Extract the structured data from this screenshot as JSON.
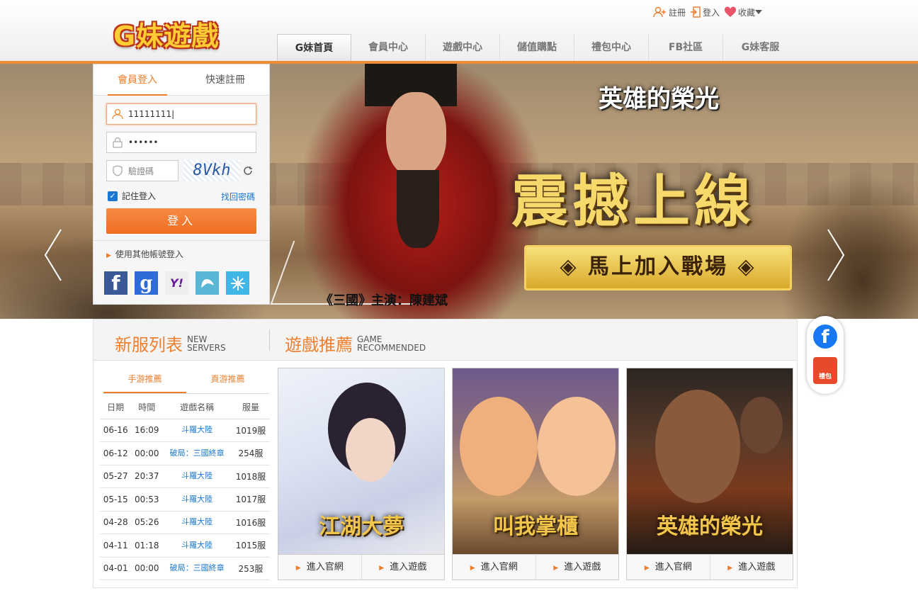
{
  "site": {
    "logo_text": "G妹遊戲"
  },
  "top_links": [
    {
      "label": "註冊",
      "icon": "add-user-icon"
    },
    {
      "label": "登入",
      "icon": "login-icon"
    },
    {
      "label": "收藏",
      "icon": "heart-icon"
    }
  ],
  "nav": [
    {
      "label": "G妹首頁",
      "active": true
    },
    {
      "label": "會員中心"
    },
    {
      "label": "遊戲中心"
    },
    {
      "label": "儲值購點"
    },
    {
      "label": "禮包中心"
    },
    {
      "label": "FB社區"
    },
    {
      "label": "G妹客服"
    }
  ],
  "login": {
    "tab_login": "會員登入",
    "tab_register": "快速註冊",
    "username_value": "11111111",
    "password_value": "••••••",
    "captcha_placeholder": "驗證碼",
    "captcha_text": "8Vkh",
    "remember_label": "記住登入",
    "forgot_label": "找回密碼",
    "login_button": "登入",
    "other_login": "使用其他帳號登入",
    "socials": [
      "facebook-icon",
      "google-icon",
      "yahoo-icon",
      "dragon-icon",
      "snowflake-icon"
    ]
  },
  "banner": {
    "game_title": "英雄的榮光",
    "slogan": "震撼上線",
    "join_button": "◈ 馬上加入戰場 ◈",
    "caption": "《三國》主演：陳建斌"
  },
  "side": {
    "gift_label": "禮包"
  },
  "sections": {
    "servers_title": "新服列表",
    "servers_sub1": "NEW",
    "servers_sub2": "SERVERS",
    "recommend_title": "遊戲推薦",
    "recommend_sub1": "GAME",
    "recommend_sub2": "RECOMMENDED"
  },
  "server_tabs": [
    "手游推薦",
    "頁游推薦"
  ],
  "server_table": {
    "headers": [
      "日期",
      "時間",
      "遊戲名稱",
      "服量"
    ],
    "rows": [
      [
        "06-16",
        "16:09",
        "斗羅大陸",
        "1019服"
      ],
      [
        "06-12",
        "00:00",
        "破局：三國終章",
        "254服"
      ],
      [
        "05-27",
        "20:37",
        "斗羅大陸",
        "1018服"
      ],
      [
        "05-15",
        "00:53",
        "斗羅大陸",
        "1017服"
      ],
      [
        "04-28",
        "05:26",
        "斗羅大陸",
        "1016服"
      ],
      [
        "04-11",
        "01:18",
        "斗羅大陸",
        "1015服"
      ],
      [
        "04-01",
        "00:00",
        "破局：三國終章",
        "253服"
      ]
    ]
  },
  "cards": [
    {
      "title": "江湖大夢",
      "btn_site": "進入官網",
      "btn_game": "進入遊戲"
    },
    {
      "title": "叫我掌櫃",
      "btn_site": "進入官網",
      "btn_game": "進入遊戲"
    },
    {
      "title": "英雄的榮光",
      "btn_site": "進入官網",
      "btn_game": "進入遊戲"
    }
  ]
}
